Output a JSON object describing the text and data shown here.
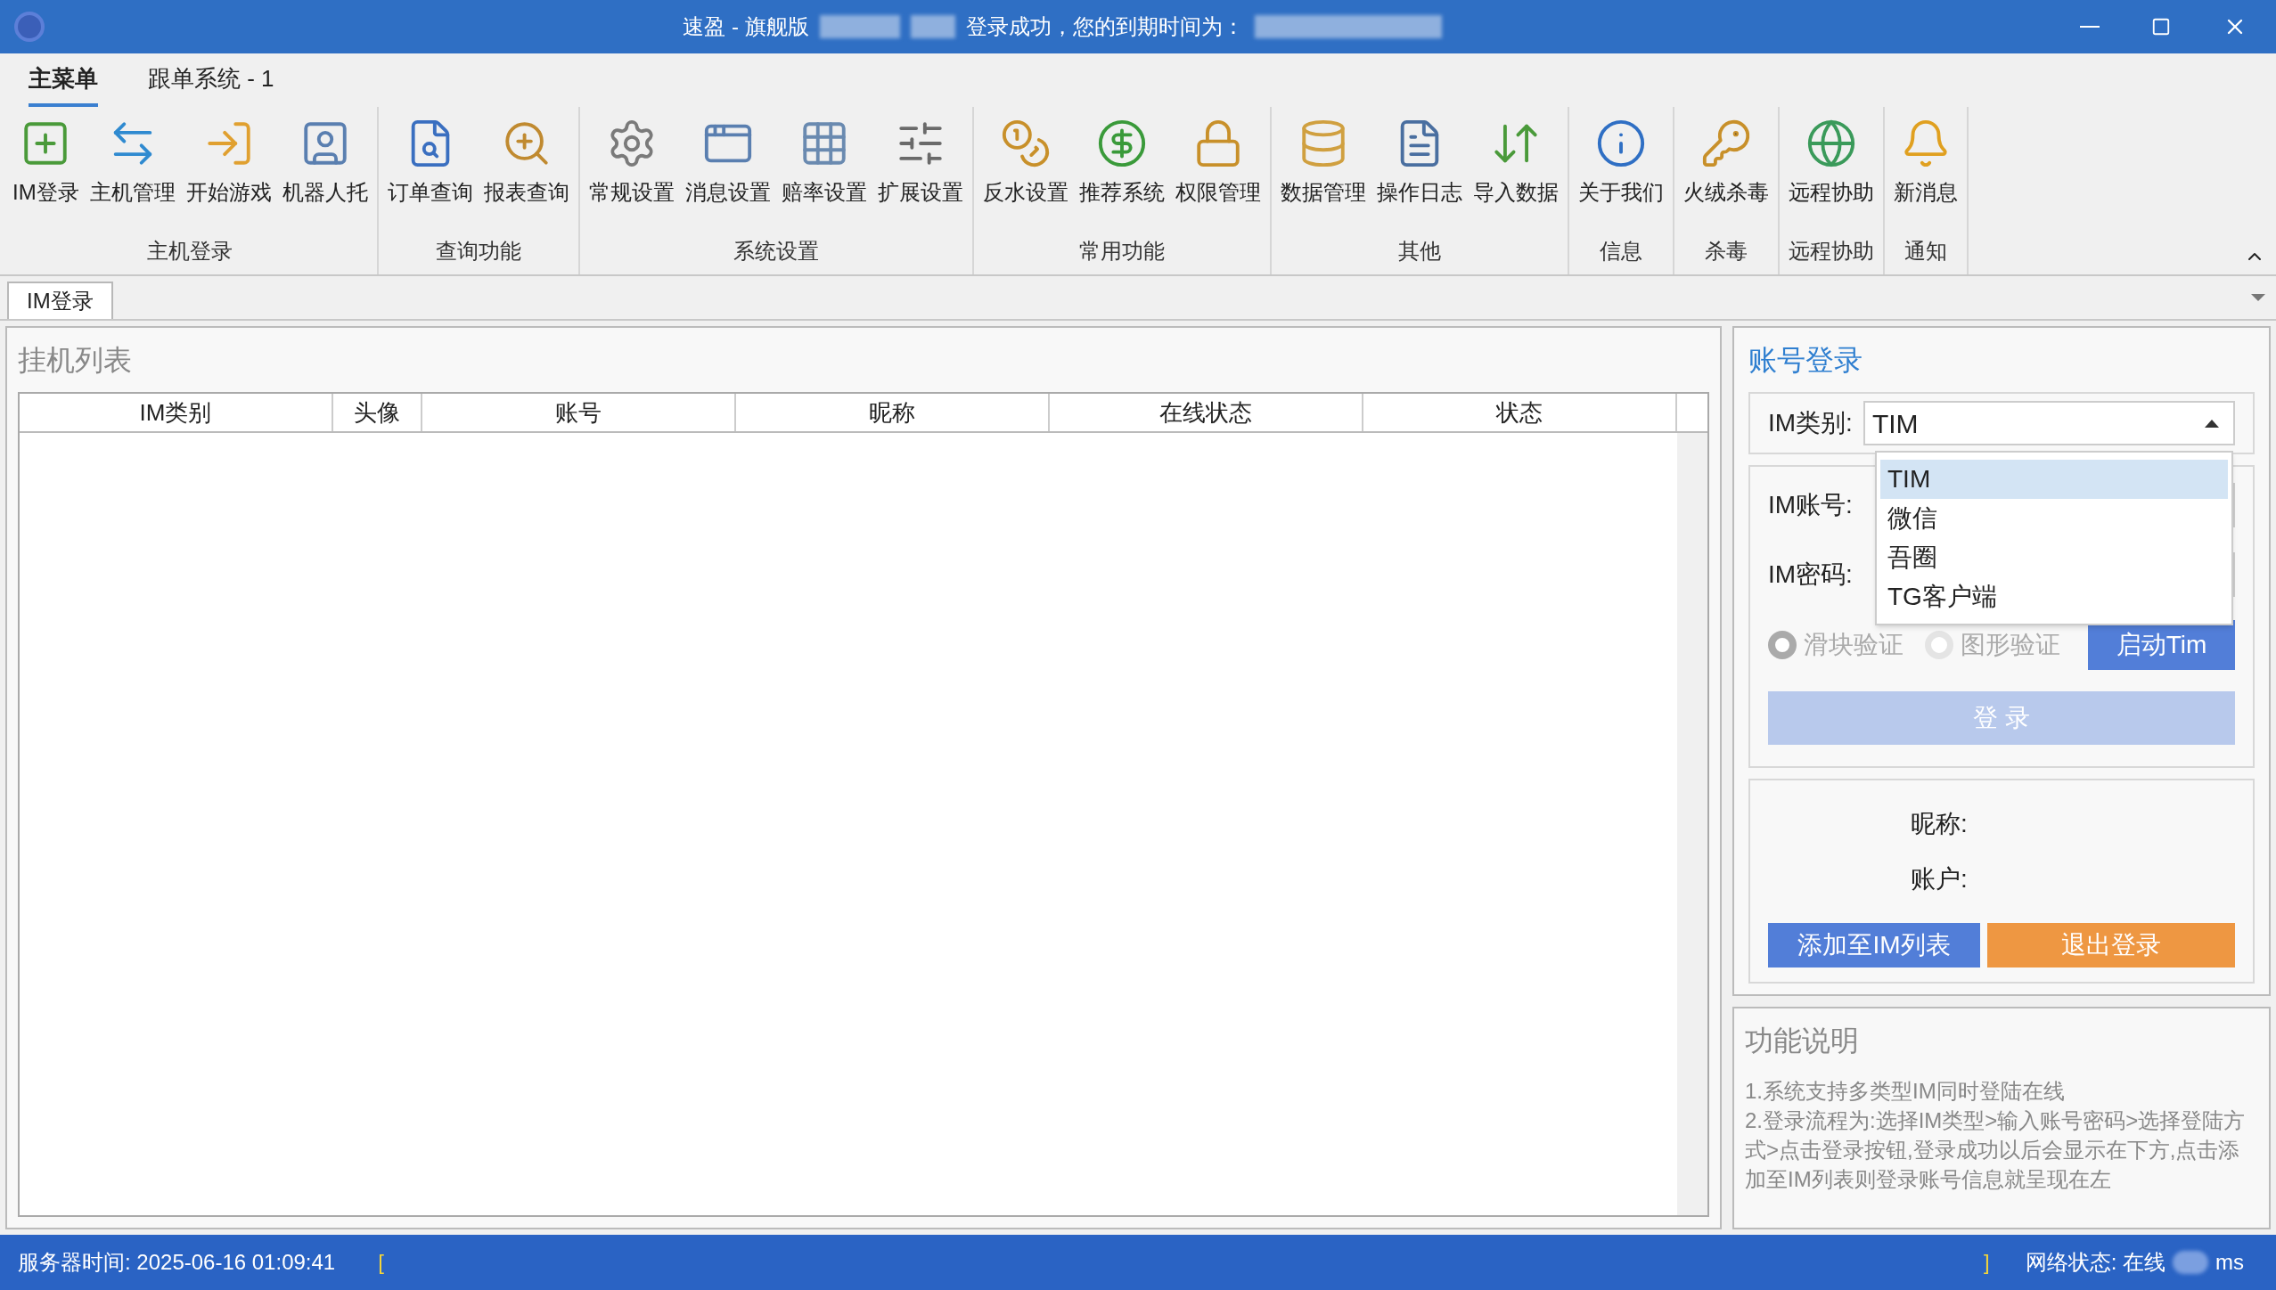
{
  "window": {
    "title_left": "速盈 - 旗舰版",
    "title_right": "登录成功，您的到期时间为："
  },
  "ribbon_tabs": [
    {
      "label": "主菜单",
      "selected": true
    },
    {
      "label": "跟单系统 - 1",
      "selected": false
    }
  ],
  "ribbon_groups": [
    {
      "label": "主机登录",
      "buttons": [
        "IM登录",
        "主机管理",
        "开始游戏",
        "机器人托"
      ]
    },
    {
      "label": "查询功能",
      "buttons": [
        "订单查询",
        "报表查询"
      ]
    },
    {
      "label": "系统设置",
      "buttons": [
        "常规设置",
        "消息设置",
        "赔率设置",
        "扩展设置"
      ]
    },
    {
      "label": "常用功能",
      "buttons": [
        "反水设置",
        "推荐系统",
        "权限管理"
      ]
    },
    {
      "label": "其他",
      "buttons": [
        "数据管理",
        "操作日志",
        "导入数据"
      ]
    },
    {
      "label": "信息",
      "buttons": [
        "关于我们"
      ]
    },
    {
      "label": "杀毒",
      "buttons": [
        "火绒杀毒"
      ]
    },
    {
      "label": "远程协助",
      "buttons": [
        "远程协助"
      ]
    },
    {
      "label": "通知",
      "buttons": [
        "新消息"
      ]
    }
  ],
  "doc_tabs": [
    {
      "label": "IM登录",
      "selected": true
    }
  ],
  "list_panel": {
    "title": "挂机列表",
    "columns": [
      "IM类别",
      "头像",
      "账号",
      "昵称",
      "在线状态",
      "状态"
    ]
  },
  "login_panel": {
    "title": "账号登录",
    "im_type": {
      "label": "IM类别:",
      "value": "TIM",
      "expanded": true,
      "options": [
        {
          "label": "TIM",
          "selected": true
        },
        {
          "label": "微信",
          "selected": false
        },
        {
          "label": "吾圈",
          "selected": false
        },
        {
          "label": "TG客户端",
          "selected": false
        }
      ]
    },
    "account_label": "IM账号:",
    "password_label": "IM密码:",
    "radios": [
      {
        "label": "滑块验证",
        "selected": true
      },
      {
        "label": "图形验证",
        "selected": false
      }
    ],
    "start_button": "启动Tim",
    "login_button": {
      "label": "登 录",
      "disabled": true
    },
    "nickname_label": "昵称:",
    "account_info_label": "账户:",
    "add_button": "添加至IM列表",
    "logout_button": "退出登录"
  },
  "help_panel": {
    "title": "功能说明",
    "lines": [
      "1.系统支持多类型IM同时登陆在线",
      "2.登录流程为:选择IM类型>输入账号密码>选择登陆方式>点击登录按钮,登录成功以后会显示在下方,点击添加至IM列表则登录账号信息就呈现在左"
    ]
  },
  "status_bar": {
    "server_time": "服务器时间: 2025-06-16 01:09:41",
    "left_mark": "[",
    "right_mark": "]",
    "network": "网络状态: 在线",
    "latency_unit": "ms"
  }
}
